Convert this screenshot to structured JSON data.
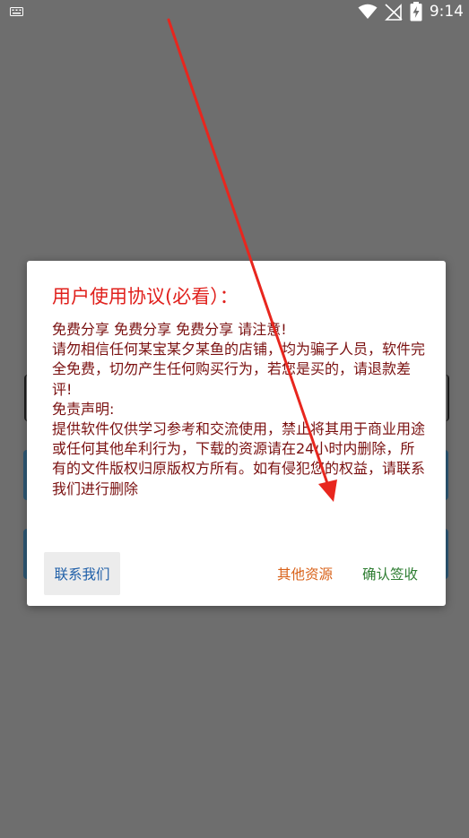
{
  "status_bar": {
    "time": "9:14",
    "icons": [
      "keyboard-icon",
      "wifi-icon",
      "signal-off-icon",
      "battery-charging-icon"
    ]
  },
  "dialog": {
    "title": "用户使用协议(必看）：",
    "body_lines": [
      "免费分享 免费分享 免费分享 请注意!",
      "请勿相信任何某宝某夕某鱼的店铺，均为骗子人员，软件完全免费，切勿产生任何购买行为，若您是买的，请退款差评!",
      "免责声明:",
      "提供软件仅供学习参考和交流使用，禁止将其用于商业用途或任何其他牟利行为，下载的资源请在24小时内删除，所有的文件版权归原版权方所有。如有侵犯您的权益，请联系我们进行删除"
    ],
    "buttons": {
      "contact": "联系我们",
      "other": "其他资源",
      "confirm": "确认签收"
    }
  },
  "colors": {
    "scrim": "#6e6e6e",
    "title": "#e0201c",
    "body": "#7a1010",
    "contact": "#1f5fa8",
    "other": "#d9621a",
    "confirm": "#2e7d32",
    "annotation_arrow": "#e8261e"
  }
}
